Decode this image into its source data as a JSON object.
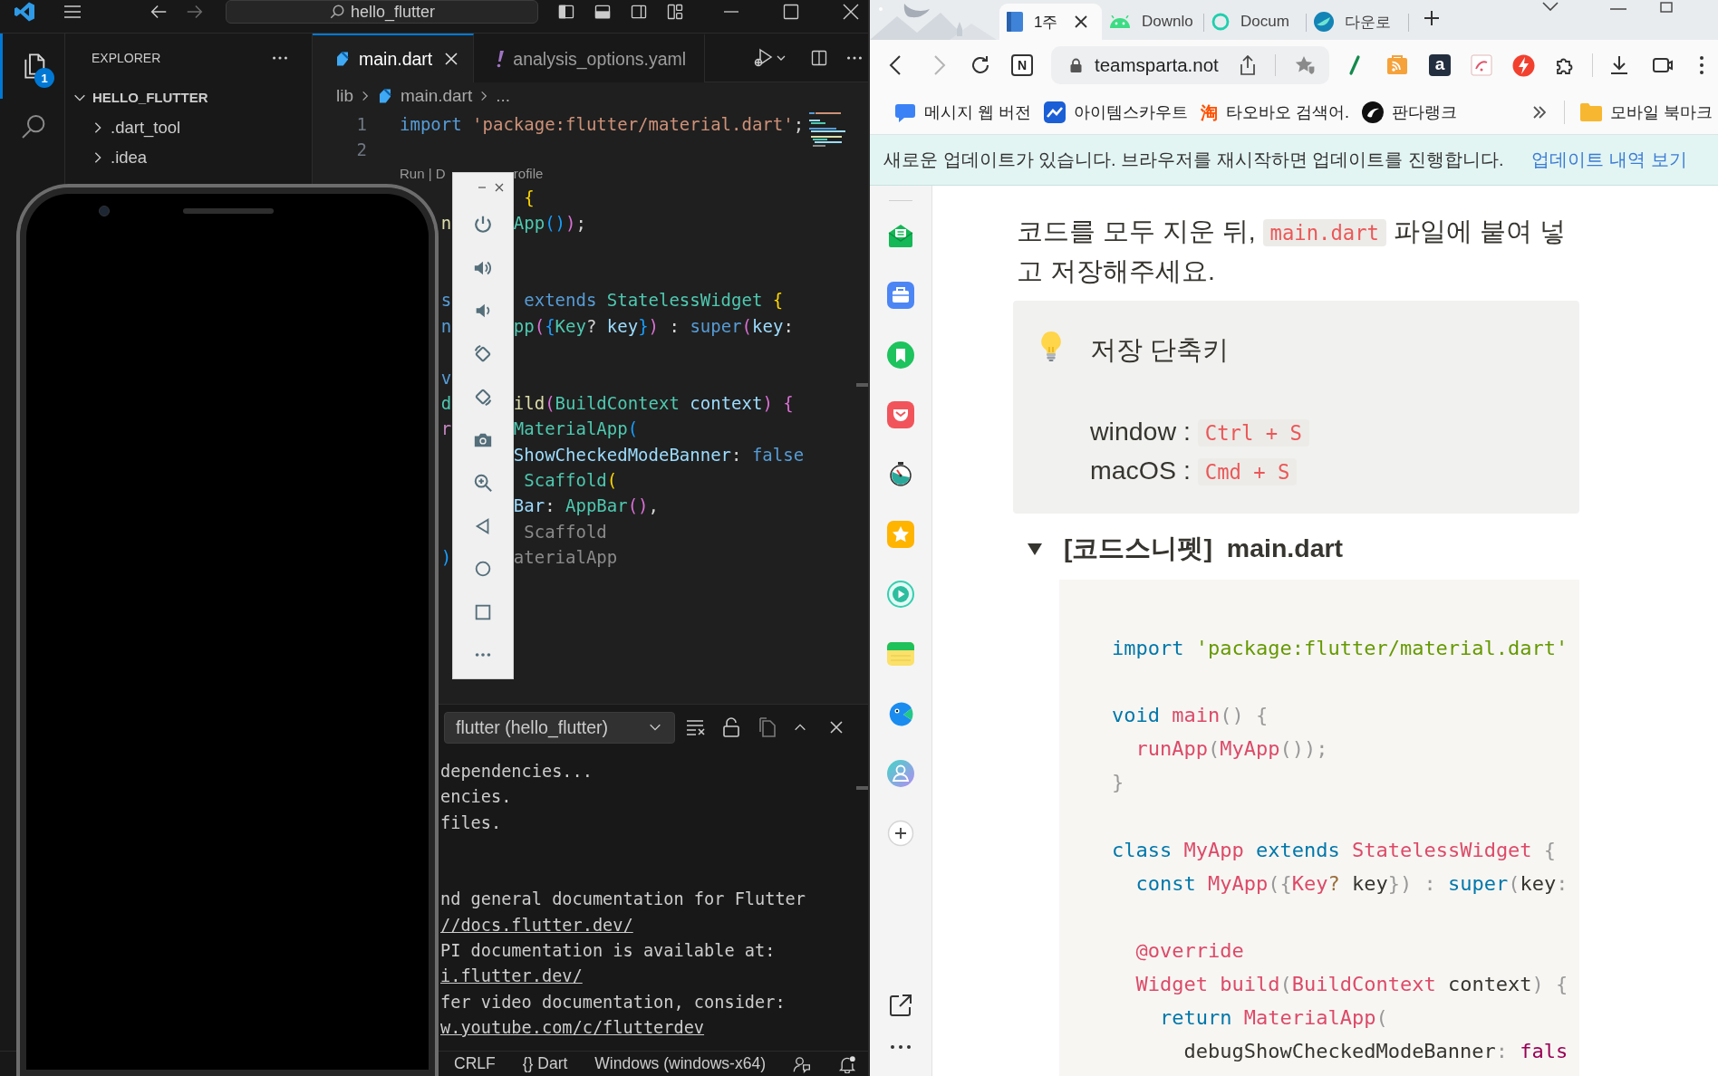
{
  "vscode": {
    "search": "hello_flutter",
    "badge": "1",
    "explorer": {
      "title": "EXPLORER",
      "tree": [
        {
          "label": "HELLO_FLUTTER",
          "expanded": true,
          "children": [
            {
              "label": ".dart_tool",
              "expanded": false
            },
            {
              "label": ".idea",
              "expanded": false
            }
          ]
        }
      ]
    },
    "tabs": [
      {
        "label": "main.dart",
        "kind": "dart",
        "selected": true
      },
      {
        "label": "analysis_options.yaml",
        "kind": "yaml",
        "selected": false
      }
    ],
    "breadcrumb": [
      {
        "label": "lib",
        "kind": "folder"
      },
      {
        "label": "main.dart",
        "kind": "dart"
      },
      {
        "label": "...",
        "kind": "symbol"
      }
    ],
    "editor_lines": [
      {
        "kind": "numbered",
        "number": "1",
        "code": [
          {
            "text": "import ",
            "kind": "keyword"
          },
          {
            "text": "'package:flutter/material.dart'",
            "kind": "string"
          },
          {
            "text": ";",
            "kind": "plain"
          }
        ]
      },
      {
        "kind": "numbered",
        "number": "2"
      },
      {
        "kind": "codelens",
        "left": "Run | D",
        "right": "rofile"
      },
      {
        "kind": "split",
        "right": [
          {
            "text": " {",
            "kind": "bracket1"
          }
        ]
      },
      {
        "kind": "split",
        "left": [
          {
            "text": "n",
            "kind": "function"
          }
        ],
        "right": [
          {
            "text": "App",
            "kind": "type"
          },
          {
            "text": "()",
            "kind": "bracket3"
          },
          {
            "text": ")",
            "kind": "bracket2"
          },
          {
            "text": ";",
            "kind": "plain"
          }
        ]
      },
      {
        "kind": "blank"
      },
      {
        "kind": "blank"
      },
      {
        "kind": "split",
        "left": [
          {
            "text": "s",
            "kind": "keyword"
          }
        ],
        "right": [
          {
            "text": " extends ",
            "kind": "keyword"
          },
          {
            "text": "StatelessWidget ",
            "kind": "type"
          },
          {
            "text": "{",
            "kind": "bracket1"
          }
        ]
      },
      {
        "kind": "split",
        "left": [
          {
            "text": "n",
            "kind": "keyword"
          }
        ],
        "right": [
          {
            "text": "pp",
            "kind": "type"
          },
          {
            "text": "(",
            "kind": "bracket2"
          },
          {
            "text": "{",
            "kind": "bracket3"
          },
          {
            "text": "Key",
            "kind": "type"
          },
          {
            "text": "? ",
            "kind": "plain"
          },
          {
            "text": "key",
            "kind": "variable"
          },
          {
            "text": "}",
            "kind": "bracket3"
          },
          {
            "text": ")",
            "kind": "bracket2"
          },
          {
            "text": " : ",
            "kind": "plain"
          },
          {
            "text": "super",
            "kind": "keyword"
          },
          {
            "text": "(",
            "kind": "bracket2"
          },
          {
            "text": "key",
            "kind": "variable"
          },
          {
            "text": ":",
            "kind": "plain"
          }
        ]
      },
      {
        "kind": "blank"
      },
      {
        "kind": "split",
        "left": [
          {
            "text": "v",
            "kind": "keyword"
          }
        ]
      },
      {
        "kind": "split",
        "left": [
          {
            "text": "d",
            "kind": "type"
          }
        ],
        "right": [
          {
            "text": "ild",
            "kind": "function"
          },
          {
            "text": "(",
            "kind": "bracket2"
          },
          {
            "text": "BuildContext ",
            "kind": "type"
          },
          {
            "text": "context",
            "kind": "variable"
          },
          {
            "text": ")",
            "kind": "bracket2"
          },
          {
            "text": " {",
            "kind": "bracket2"
          }
        ]
      },
      {
        "kind": "split",
        "left": [
          {
            "text": "r",
            "kind": "control"
          }
        ],
        "right": [
          {
            "text": "MaterialApp",
            "kind": "type"
          },
          {
            "text": "(",
            "kind": "bracket3"
          }
        ]
      },
      {
        "kind": "split",
        "right": [
          {
            "text": "ShowCheckedModeBanner",
            "kind": "variable"
          },
          {
            "text": ": ",
            "kind": "plain"
          },
          {
            "text": "false",
            "kind": "keyword"
          }
        ]
      },
      {
        "kind": "split",
        "right": [
          {
            "text": " Scaffold",
            "kind": "type"
          },
          {
            "text": "(",
            "kind": "bracket1"
          }
        ]
      },
      {
        "kind": "split",
        "right": [
          {
            "text": "Bar",
            "kind": "variable"
          },
          {
            "text": ": ",
            "kind": "plain"
          },
          {
            "text": "AppBar",
            "kind": "type"
          },
          {
            "text": "()",
            "kind": "bracket2"
          },
          {
            "text": ",",
            "kind": "plain"
          }
        ]
      },
      {
        "kind": "split",
        "right": [
          {
            "text": " Scaffold",
            "kind": "label"
          }
        ]
      },
      {
        "kind": "split",
        "left": [
          {
            "text": ")",
            "kind": "bracket3"
          }
        ],
        "right": [
          {
            "text": "aterialApp",
            "kind": "label"
          }
        ]
      }
    ],
    "output": {
      "channel": "flutter (hello_flutter)",
      "lines": [
        {
          "kind": "text",
          "text": "dependencies..."
        },
        {
          "kind": "text",
          "text": "encies."
        },
        {
          "kind": "text",
          "text": "files."
        },
        {
          "kind": "blank"
        },
        {
          "kind": "blank"
        },
        {
          "kind": "text",
          "text": "nd general documentation for Flutter"
        },
        {
          "kind": "link",
          "text": "//docs.flutter.dev/"
        },
        {
          "kind": "text",
          "text": "PI documentation is available at:"
        },
        {
          "kind": "link",
          "text": "i.flutter.dev/"
        },
        {
          "kind": "text",
          "text": "fer video documentation, consider:"
        },
        {
          "kind": "link",
          "text": "w.youtube.com/c/flutterdev"
        }
      ]
    },
    "status_bar": [
      "CRLF",
      "{} Dart",
      "Windows (windows-x64)"
    ]
  },
  "browser": {
    "tabs": [
      {
        "label": "1주",
        "kind": "book",
        "selected": true
      },
      {
        "label": "Downlo",
        "kind": "robot",
        "selected": false
      },
      {
        "label": "Docum",
        "kind": "ring",
        "selected": false
      },
      {
        "label": "다운로",
        "kind": "whale",
        "selected": false
      }
    ],
    "page_button": "N",
    "address": "teamsparta.not",
    "extension_letter": "a",
    "bookmarks": [
      {
        "label": "메시지 웹 버전",
        "kind": "bubble"
      },
      {
        "label": "아이템스카우트",
        "kind": "chart"
      },
      {
        "label": "타오바오 검색어.",
        "kind": "glyph",
        "glyph": "淘"
      },
      {
        "label": "판다랭크",
        "kind": "swirl"
      }
    ],
    "bookmark_folder": "모바일 북마크",
    "update_bar": {
      "message": "새로운 업데이트가 있습니다. 브라우저를 재시작하면 업데이트를 진행합니다.",
      "link": "업데이트 내역 보기"
    },
    "page": {
      "paragraph": [
        {
          "text": "코드를 모두 지운 뒤, ",
          "kind": "plain"
        },
        {
          "text": "main.dart",
          "kind": "code"
        },
        {
          "text": " 파일에 붙여 넣고 저장해주세요.",
          "kind": "plain"
        }
      ],
      "callout": {
        "title": "저장 단축키",
        "lines": [
          [
            {
              "text": "window : ",
              "kind": "plain"
            },
            {
              "text": "Ctrl + S",
              "kind": "code"
            }
          ],
          [
            {
              "text": "macOS : ",
              "kind": "plain"
            },
            {
              "text": "Cmd + S",
              "kind": "code"
            }
          ]
        ]
      },
      "toggle": {
        "title": "[코드스니펫]  main.dart",
        "expanded": true
      },
      "code_lines": [
        {
          "kind": "code",
          "tokens": [
            {
              "text": "import ",
              "kind": "keyword"
            },
            {
              "text": "'package:flutter/material.dart'",
              "kind": "string"
            }
          ]
        },
        {
          "kind": "blank"
        },
        {
          "kind": "code",
          "tokens": [
            {
              "text": "void ",
              "kind": "keyword"
            },
            {
              "text": "main",
              "kind": "function"
            },
            {
              "text": "() {",
              "kind": "punct"
            }
          ]
        },
        {
          "kind": "code",
          "tokens": [
            {
              "text": "  runApp",
              "kind": "function"
            },
            {
              "text": "(",
              "kind": "punct"
            },
            {
              "text": "MyApp",
              "kind": "function"
            },
            {
              "text": "());",
              "kind": "punct"
            }
          ]
        },
        {
          "kind": "code",
          "tokens": [
            {
              "text": "}",
              "kind": "punct"
            }
          ]
        },
        {
          "kind": "blank"
        },
        {
          "kind": "code",
          "tokens": [
            {
              "text": "class ",
              "kind": "keyword"
            },
            {
              "text": "MyApp ",
              "kind": "function"
            },
            {
              "text": "extends ",
              "kind": "keyword"
            },
            {
              "text": "StatelessWidget ",
              "kind": "function"
            },
            {
              "text": "{",
              "kind": "punct"
            }
          ]
        },
        {
          "kind": "code",
          "tokens": [
            {
              "text": "  const ",
              "kind": "keyword"
            },
            {
              "text": "MyApp",
              "kind": "function"
            },
            {
              "text": "({",
              "kind": "punct"
            },
            {
              "text": "Key",
              "kind": "function"
            },
            {
              "text": "?",
              "kind": "operator"
            },
            {
              "text": " key",
              "kind": "plain"
            },
            {
              "text": "}) : ",
              "kind": "punct"
            },
            {
              "text": "super",
              "kind": "keyword"
            },
            {
              "text": "(",
              "kind": "punct"
            },
            {
              "text": "key",
              "kind": "plain"
            },
            {
              "text": ":",
              "kind": "punct"
            }
          ]
        },
        {
          "kind": "blank"
        },
        {
          "kind": "code",
          "tokens": [
            {
              "text": "  @override",
              "kind": "function"
            }
          ]
        },
        {
          "kind": "code",
          "tokens": [
            {
              "text": "  Widget ",
              "kind": "function"
            },
            {
              "text": "build",
              "kind": "function"
            },
            {
              "text": "(",
              "kind": "punct"
            },
            {
              "text": "BuildContext ",
              "kind": "function"
            },
            {
              "text": "context",
              "kind": "plain"
            },
            {
              "text": ") {",
              "kind": "punct"
            }
          ]
        },
        {
          "kind": "code",
          "tokens": [
            {
              "text": "    return ",
              "kind": "keyword"
            },
            {
              "text": "MaterialApp",
              "kind": "function"
            },
            {
              "text": "(",
              "kind": "punct"
            }
          ]
        },
        {
          "kind": "code",
          "tokens": [
            {
              "text": "      debugShowCheckedModeBanner",
              "kind": "plain"
            },
            {
              "text": ": ",
              "kind": "punct"
            },
            {
              "text": "fals",
              "kind": "boolean"
            }
          ]
        }
      ]
    }
  }
}
